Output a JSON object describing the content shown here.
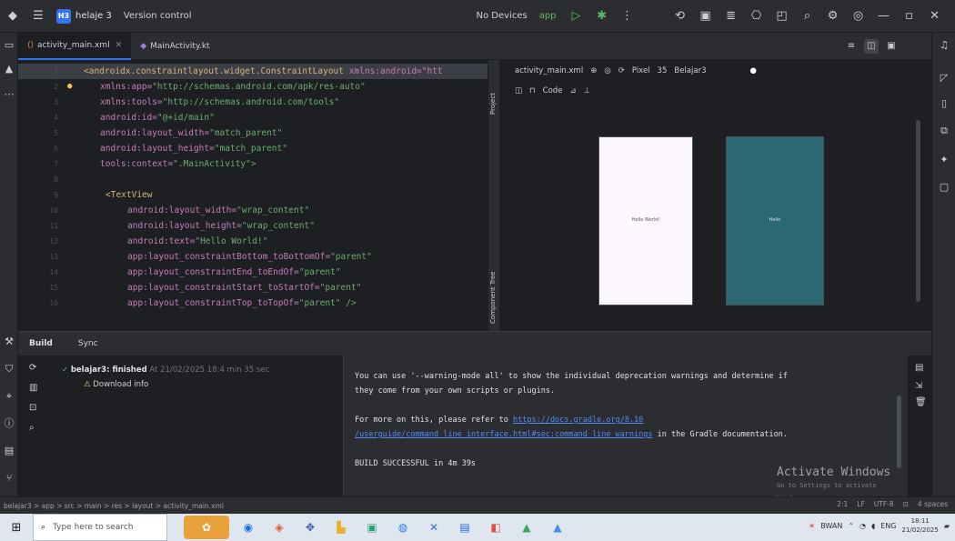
{
  "titlebar": {
    "project_name": "helaje 3",
    "project_badge": "H3",
    "vcs_label": "Version control",
    "devices_label": "No Devices",
    "run_config": "app"
  },
  "tabs": [
    {
      "label": "activity_main.xml"
    },
    {
      "label": "MainActivity.kt"
    }
  ],
  "editor": {
    "lines": [
      {
        "num": "1",
        "html_tag": "<androidx.constraintlayout.widget.ConstraintLayout",
        "rest": " xmlns:android=\"htt"
      },
      {
        "num": "2",
        "attr": "xmlns:app=",
        "val": "\"http://schemas.android.com/apk/res-auto\""
      },
      {
        "num": "3",
        "attr": "xmlns:tools=",
        "val": "\"http://schemas.android.com/tools\""
      },
      {
        "num": "4",
        "attr": "android:id=",
        "val": "\"@+id/main\""
      },
      {
        "num": "5",
        "attr": "android:layout_width=",
        "val": "\"match_parent\""
      },
      {
        "num": "6",
        "attr": "android:layout_height=",
        "val": "\"match_parent\""
      },
      {
        "num": "7",
        "attr": "tools:context=",
        "val": "\".MainActivity\">"
      },
      {
        "num": "8",
        "attr": "",
        "val": ""
      },
      {
        "num": "9",
        "attr": "<TextView",
        "val": ""
      },
      {
        "num": "10",
        "attr": "android:layout_width=",
        "val": "\"wrap_content\""
      },
      {
        "num": "11",
        "attr": "android:layout_height=",
        "val": "\"wrap_content\""
      },
      {
        "num": "12",
        "attr": "android:text=",
        "val": "\"Hello World!\""
      },
      {
        "num": "13",
        "attr": "app:layout_constraintBottom_toBottomOf=",
        "val": "\"parent\""
      },
      {
        "num": "14",
        "attr": "app:layout_constraintEnd_toEndOf=",
        "val": "\"parent\""
      },
      {
        "num": "15",
        "attr": "app:layout_constraintStart_toStartOf=",
        "val": "\"parent\""
      },
      {
        "num": "16",
        "attr": "app:layout_constraintTop_toTopOf=",
        "val": "\"parent\" />"
      }
    ]
  },
  "side_labels": {
    "project": "Project",
    "component_tree": "Component Tree"
  },
  "design": {
    "file_label": "activity_main.xml",
    "device_label": "Pixel",
    "api_label": "35",
    "theme_label": "Belajar3",
    "code_label": "Code",
    "light_preview_text": "Hello World!",
    "dark_preview_text": "Hello"
  },
  "build": {
    "title": "Build",
    "sync_label": "Sync",
    "tree_root": "belajar3: finished",
    "tree_root_detail": "At 21/02/2025 18:4 min 35 sec",
    "tree_child": "Download info",
    "output": {
      "line1": "You can use '--warning-mode all' to show the individual deprecation warnings and determine if",
      "line2": "they come from your own scripts or plugins.",
      "line3_prefix": "For more on this, please refer to ",
      "link1": "https://docs.gradle.org/8.10",
      "link2": "/userguide/command_line_interface.html#sec:command_line_warnings",
      "line4_suffix": " in the Gradle documentation.",
      "line5": "BUILD SUCCESSFUL in 4m 39s"
    },
    "watermark_title": "Activate Windows",
    "watermark_sub": "Go to Settings to activate Windows."
  },
  "statusbar": {
    "breadcrumb": "belajar3 > app > src > main > res > layout > activity_main.xml",
    "position": "2:1",
    "line_ending": "LF",
    "encoding": "UTF-8",
    "indent": "4 spaces"
  },
  "taskbar": {
    "search_placeholder": "Type here to search",
    "tray_label": "BWAN",
    "lang": "ENG",
    "time": "18:11",
    "date": "21/02/2025"
  },
  "colors": {
    "accent": "#3574f0",
    "success": "#5fb865",
    "preview_dark": "#2b6874"
  }
}
